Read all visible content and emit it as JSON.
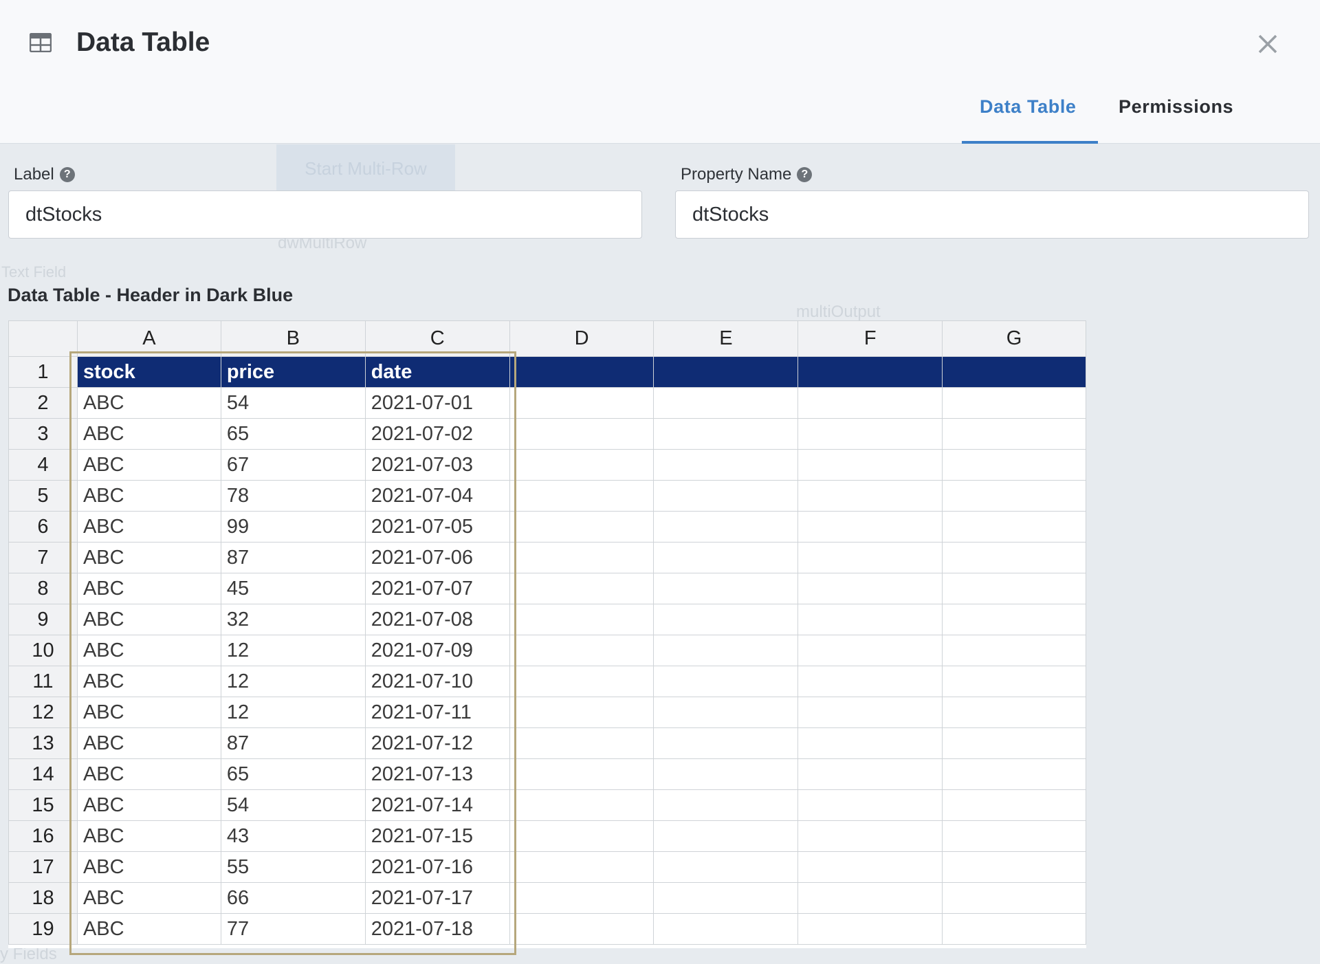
{
  "header": {
    "title": "Data Table",
    "close_glyph": "×",
    "tabs": [
      {
        "label": "Data Table",
        "active": true
      },
      {
        "label": "Permissions",
        "active": false
      }
    ]
  },
  "icons": [
    "table-grid-icon",
    "close-icon",
    "help-icon"
  ],
  "form": {
    "label": {
      "label": "Label",
      "value": "dtStocks"
    },
    "property_name": {
      "label": "Property Name",
      "value": "dtStocks"
    }
  },
  "table_label": "Data Table - Header in Dark Blue",
  "background_ghosts": {
    "button": "Start Multi-Row",
    "row_name": "dwMultiRow",
    "text_field": "Text Field",
    "multi_output": "multiOutput",
    "fields": "y Fields"
  },
  "sheet": {
    "columns": [
      "A",
      "B",
      "C",
      "D",
      "E",
      "F",
      "G"
    ],
    "rows": [
      [
        "1",
        "stock",
        "price",
        "date",
        "",
        "",
        "",
        ""
      ],
      [
        "2",
        "ABC",
        "54",
        "2021-07-01",
        "",
        "",
        "",
        ""
      ],
      [
        "3",
        "ABC",
        "65",
        "2021-07-02",
        "",
        "",
        "",
        ""
      ],
      [
        "4",
        "ABC",
        "67",
        "2021-07-03",
        "",
        "",
        "",
        ""
      ],
      [
        "5",
        "ABC",
        "78",
        "2021-07-04",
        "",
        "",
        "",
        ""
      ],
      [
        "6",
        "ABC",
        "99",
        "2021-07-05",
        "",
        "",
        "",
        ""
      ],
      [
        "7",
        "ABC",
        "87",
        "2021-07-06",
        "",
        "",
        "",
        ""
      ],
      [
        "8",
        "ABC",
        "45",
        "2021-07-07",
        "",
        "",
        "",
        ""
      ],
      [
        "9",
        "ABC",
        "32",
        "2021-07-08",
        "",
        "",
        "",
        ""
      ],
      [
        "10",
        "ABC",
        "12",
        "2021-07-09",
        "",
        "",
        "",
        ""
      ],
      [
        "11",
        "ABC",
        "12",
        "2021-07-10",
        "",
        "",
        "",
        ""
      ],
      [
        "12",
        "ABC",
        "12",
        "2021-07-11",
        "",
        "",
        "",
        ""
      ],
      [
        "13",
        "ABC",
        "87",
        "2021-07-12",
        "",
        "",
        "",
        ""
      ],
      [
        "14",
        "ABC",
        "65",
        "2021-07-13",
        "",
        "",
        "",
        ""
      ],
      [
        "15",
        "ABC",
        "54",
        "2021-07-14",
        "",
        "",
        "",
        ""
      ],
      [
        "16",
        "ABC",
        "43",
        "2021-07-15",
        "",
        "",
        "",
        ""
      ],
      [
        "17",
        "ABC",
        "55",
        "2021-07-16",
        "",
        "",
        "",
        ""
      ],
      [
        "18",
        "ABC",
        "66",
        "2021-07-17",
        "",
        "",
        "",
        ""
      ],
      [
        "19",
        "ABC",
        "77",
        "2021-07-18",
        "",
        "",
        "",
        ""
      ]
    ]
  },
  "colors": {
    "header_row_bg": "#0f2c74",
    "accent": "#3d80c8",
    "selection_border": "#b6a77c"
  }
}
